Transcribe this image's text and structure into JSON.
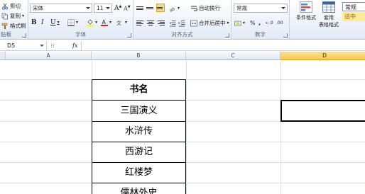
{
  "ribbon": {
    "clipboard": {
      "cut": "剪切",
      "copy": "复制",
      "format_painter": "格式刷",
      "group_label": "贴板"
    },
    "font": {
      "font_name": "宋体",
      "font_size": "11",
      "bold": "B",
      "italic": "I",
      "underline": "U",
      "group_label": "字体"
    },
    "alignment": {
      "wrap_text": "自动换行",
      "merge_center": "合并后居中",
      "group_label": "对齐方式"
    },
    "number": {
      "format": "常规",
      "percent": "%",
      "comma": ",",
      "group_label": "数字"
    },
    "styles": {
      "conditional_format": "条件格式",
      "table_format_line1": "套用",
      "table_format_line2": "表格格式",
      "normal_style": "常规",
      "neutral_style": "适中"
    }
  },
  "formula_bar": {
    "name_box": "D5",
    "fx": "fx",
    "content": ""
  },
  "grid": {
    "columns": [
      "A",
      "B",
      "C",
      "D"
    ],
    "selected_column": "D",
    "cells": [
      "书名",
      "三国演义",
      "水浒传",
      "西游记",
      "红楼梦",
      "儒林外史"
    ]
  },
  "colors": {
    "ribbon_bg": "#e2eaf5",
    "selected_header": "#f8c85a",
    "neutral_style": "#ffeb9c"
  }
}
